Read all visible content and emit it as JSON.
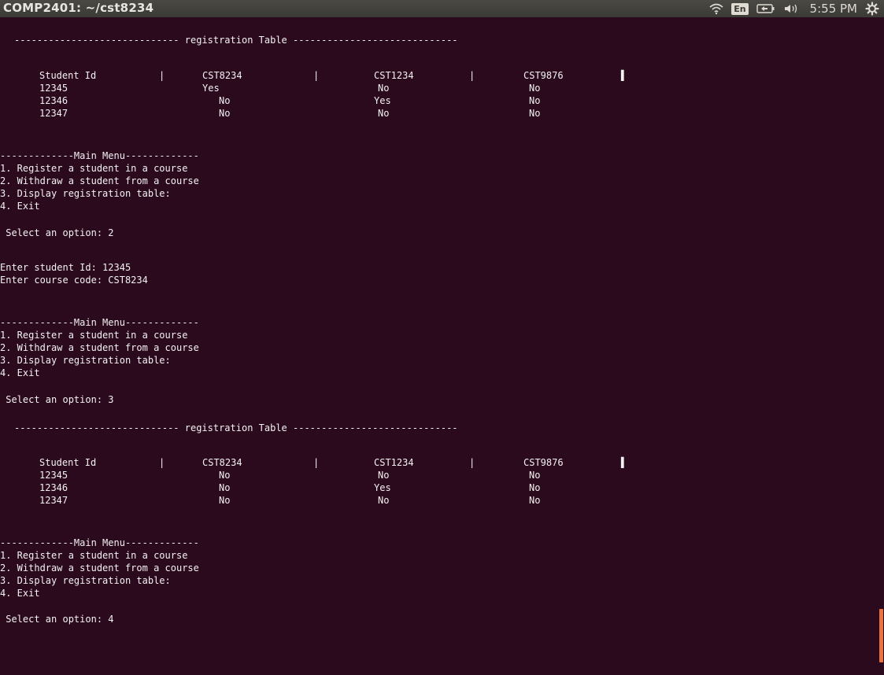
{
  "window": {
    "title": "COMP2401: ~/cst8234"
  },
  "panel": {
    "language": "En",
    "clock": "5:55 PM",
    "icons": [
      "wifi-icon",
      "keyboard-language-icon",
      "battery-icon",
      "volume-icon",
      "settings-gear-icon"
    ]
  },
  "terminal": {
    "colors": {
      "background": "#2c0a1e",
      "text": "#f2f2f2",
      "scroll_thumb": "#e8733f"
    },
    "table_title_line": "----------------------------- registration Table -----------------------------",
    "table_header": {
      "col0": "Student Id",
      "col1": "CST8234",
      "col2": "CST1234",
      "col3": "CST9876",
      "sep": "|",
      "end_marker": "▌"
    },
    "table1_rows": [
      {
        "id": "12345",
        "c1": "Yes",
        "c2": "No",
        "c3": "No"
      },
      {
        "id": "12346",
        "c1": "No",
        "c2": "Yes",
        "c3": "No"
      },
      {
        "id": "12347",
        "c1": "No",
        "c2": "No",
        "c3": "No"
      }
    ],
    "table2_rows": [
      {
        "id": "12345",
        "c1": "No",
        "c2": "No",
        "c3": "No"
      },
      {
        "id": "12346",
        "c1": "No",
        "c2": "Yes",
        "c3": "No"
      },
      {
        "id": "12347",
        "c1": "No",
        "c2": "No",
        "c3": "No"
      }
    ],
    "menu": {
      "header": "-------------Main Menu-------------",
      "item1": "1. Register a student in a course",
      "item2": "2. Withdraw a student from a course",
      "item3": "3. Display registration table:",
      "item4": "4. Exit"
    },
    "prompt1": " Select an option: 2",
    "enter_id": "Enter student Id: 12345",
    "enter_course": "Enter course code: CST8234",
    "prompt2": " Select an option: 3",
    "prompt3": " Select an option: 4"
  }
}
